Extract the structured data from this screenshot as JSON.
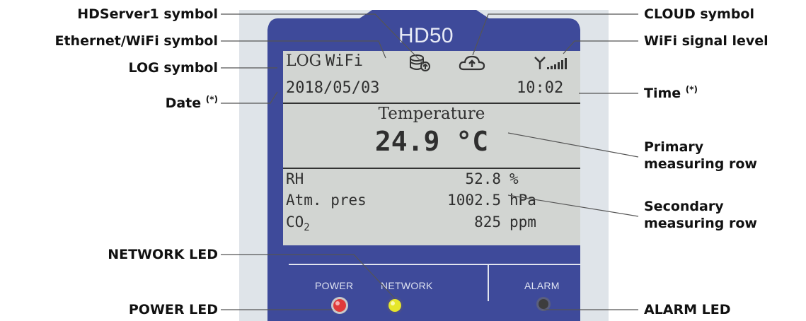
{
  "device": {
    "model": "HD50",
    "display": {
      "log": "LOG",
      "wifi": "WiFi",
      "date": "2018/05/03",
      "time": "10:02",
      "primary_name": "Temperature",
      "primary_value": "24.9 °C",
      "rows": [
        {
          "name": "RH",
          "value": "52.8",
          "unit": "%"
        },
        {
          "name": "Atm. pres",
          "value": "1002.5",
          "unit": "hPa"
        },
        {
          "name": "CO",
          "sub": "2",
          "value": "825",
          "unit": "ppm"
        }
      ]
    },
    "panel_labels": {
      "power": "POWER",
      "network": "NETWORK",
      "alarm": "ALARM"
    },
    "colors": {
      "frame": "#3e4a9a",
      "lcd": "#d2d5d2",
      "power_led": "#e03a3a",
      "network_led": "#e6e62a",
      "alarm_led": "#3d3d3d"
    }
  },
  "labels": {
    "hdserver": "HDServer1 symbol",
    "ethernet_wifi": "Ethernet/WiFi symbol",
    "log": "LOG symbol",
    "date": "Date",
    "date_note": "(*)",
    "cloud": "CLOUD symbol",
    "wifi_signal": "WiFi signal level",
    "time": "Time",
    "time_note": "(*)",
    "primary_line1": "Primary",
    "primary_line2": "measuring row",
    "secondary_line1": "Secondary",
    "secondary_line2": "measuring row",
    "network_led": "NETWORK LED",
    "power_led": "POWER LED",
    "alarm_led": "ALARM LED"
  }
}
